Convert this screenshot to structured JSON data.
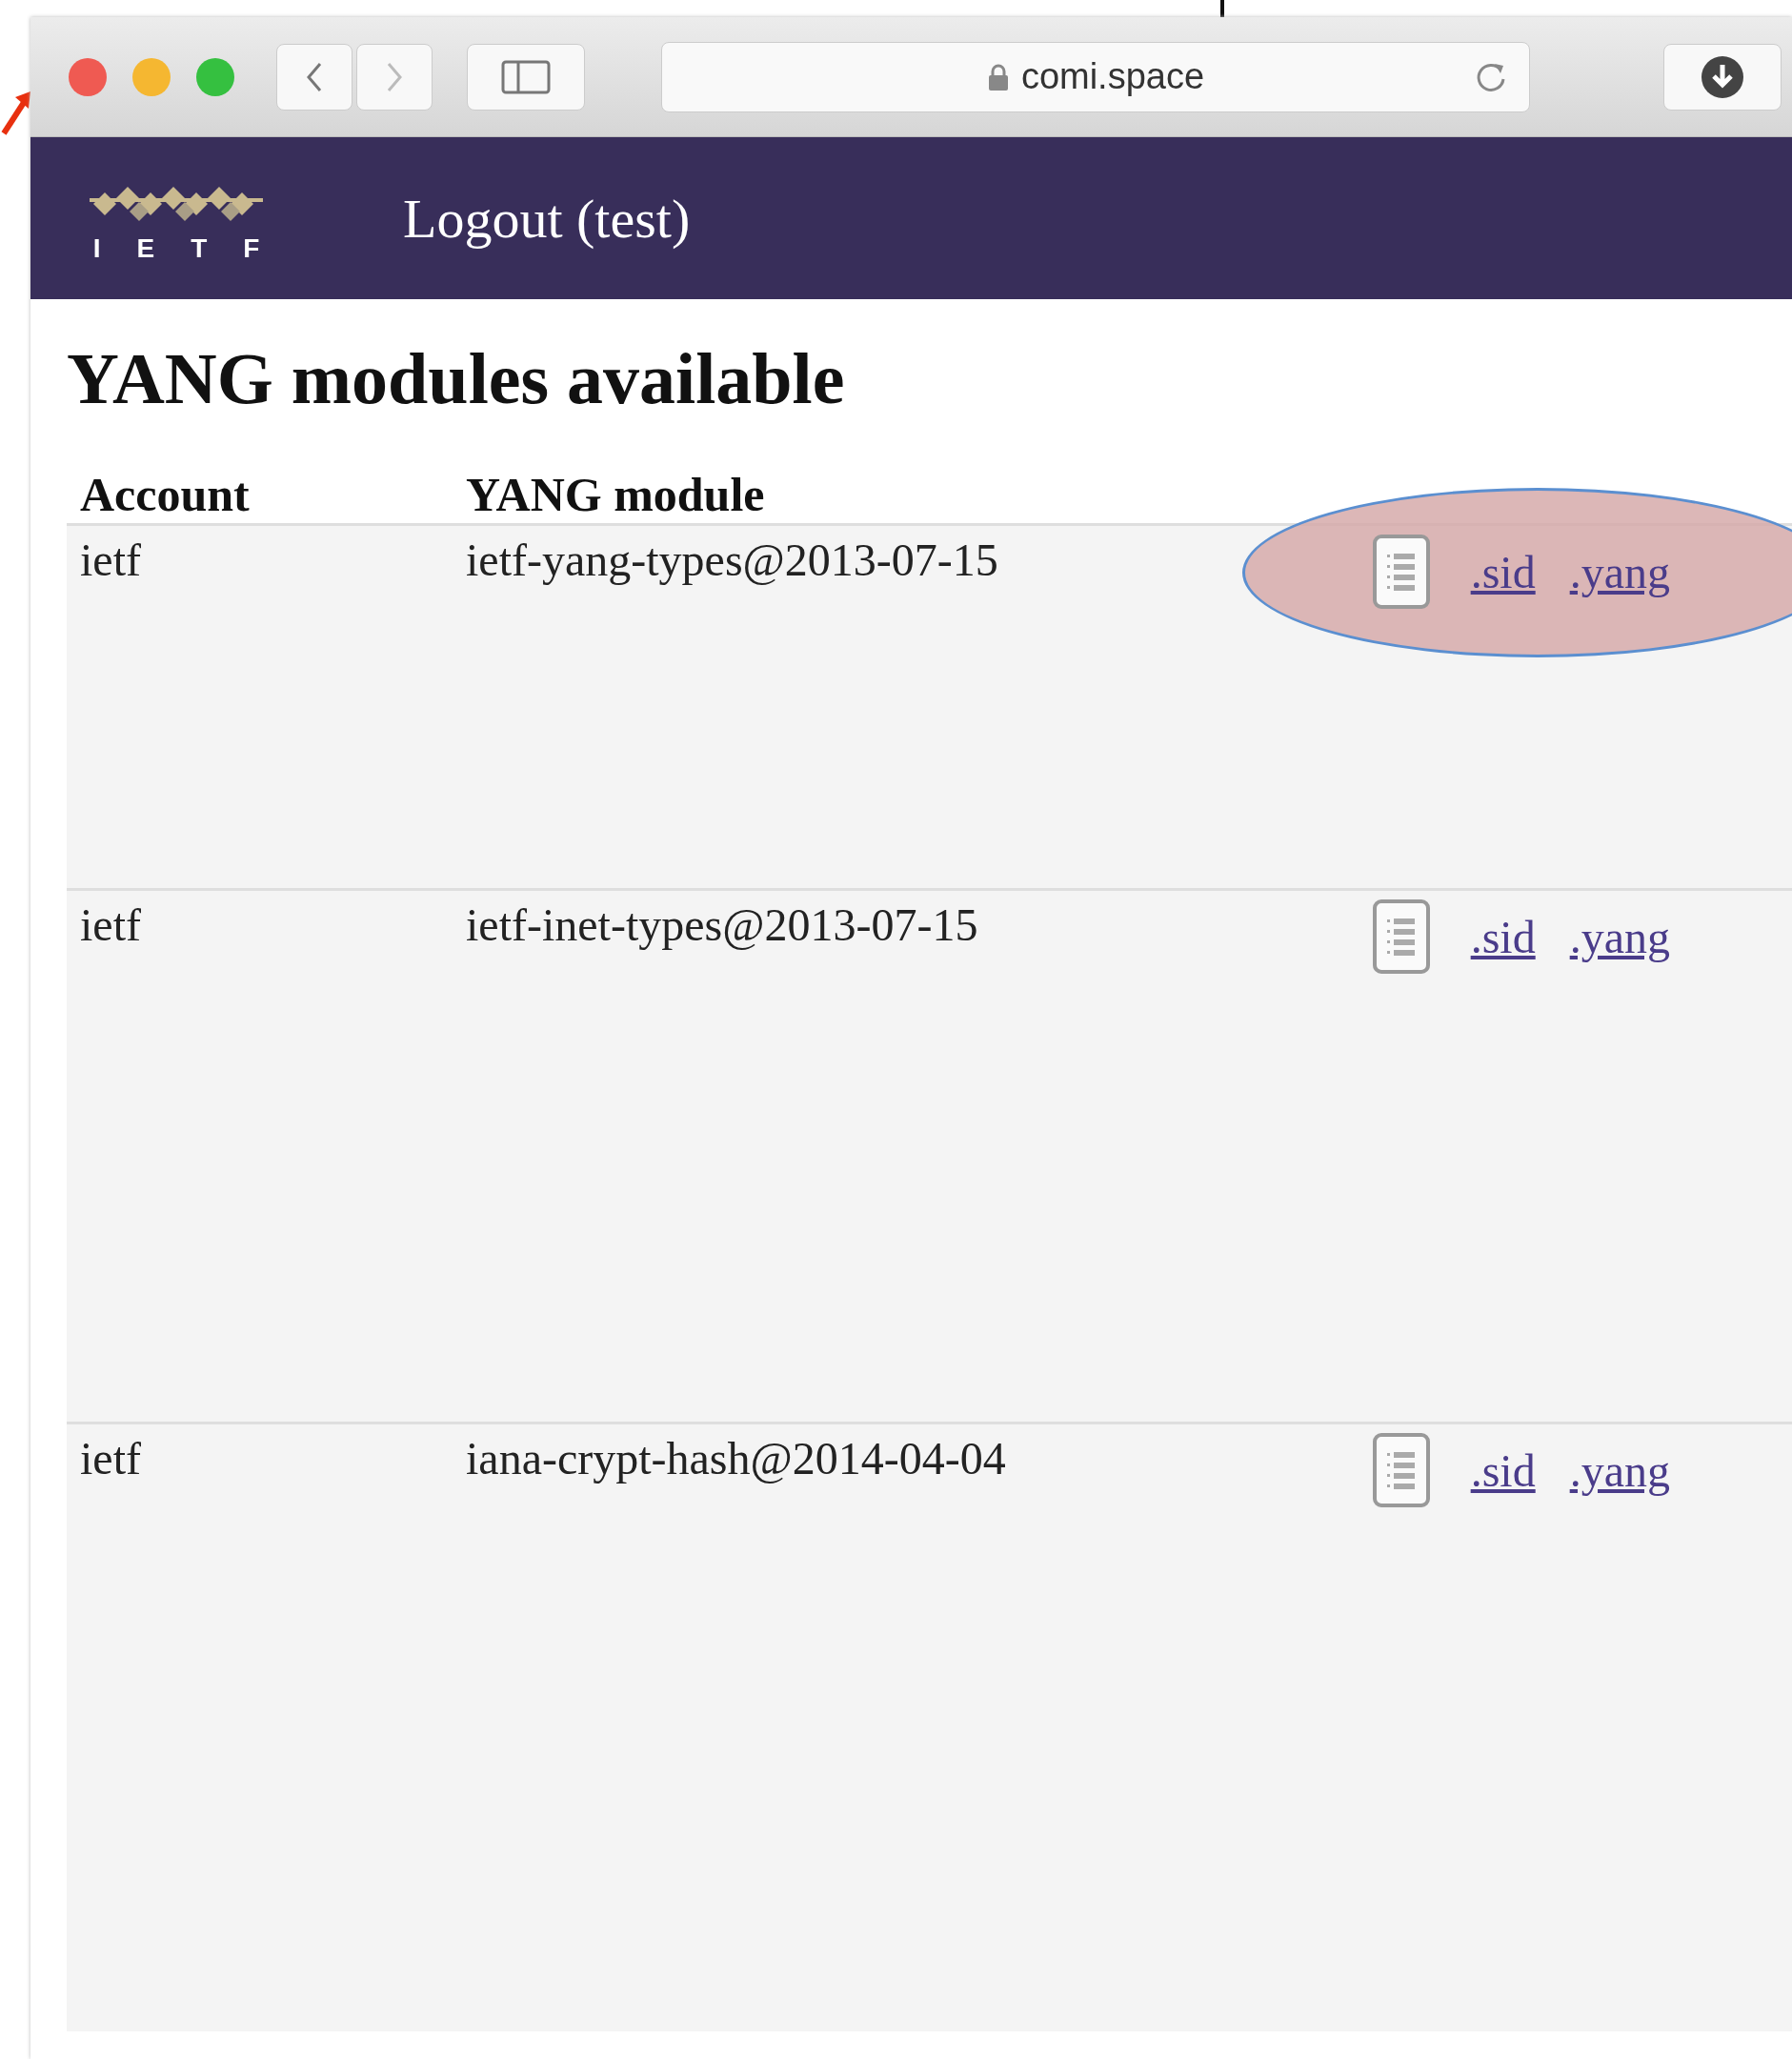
{
  "browser": {
    "url": "comi.space"
  },
  "header": {
    "logo_letters": [
      "I",
      "E",
      "T",
      "F"
    ],
    "nav_link": "Logout (test)"
  },
  "page_title": "YANG modules available",
  "table": {
    "columns": [
      "Account",
      "YANG module"
    ],
    "rows": [
      {
        "account": "ietf",
        "module": "ietf-yang-types@2013-07-15",
        "links": [
          ".sid",
          ".yang"
        ],
        "highlighted": true
      },
      {
        "account": "ietf",
        "module": "ietf-inet-types@2013-07-15",
        "links": [
          ".sid",
          ".yang"
        ],
        "highlighted": false
      },
      {
        "account": "ietf",
        "module": "iana-crypt-hash@2014-04-04",
        "links": [
          ".sid",
          ".yang"
        ],
        "highlighted": false
      }
    ]
  }
}
